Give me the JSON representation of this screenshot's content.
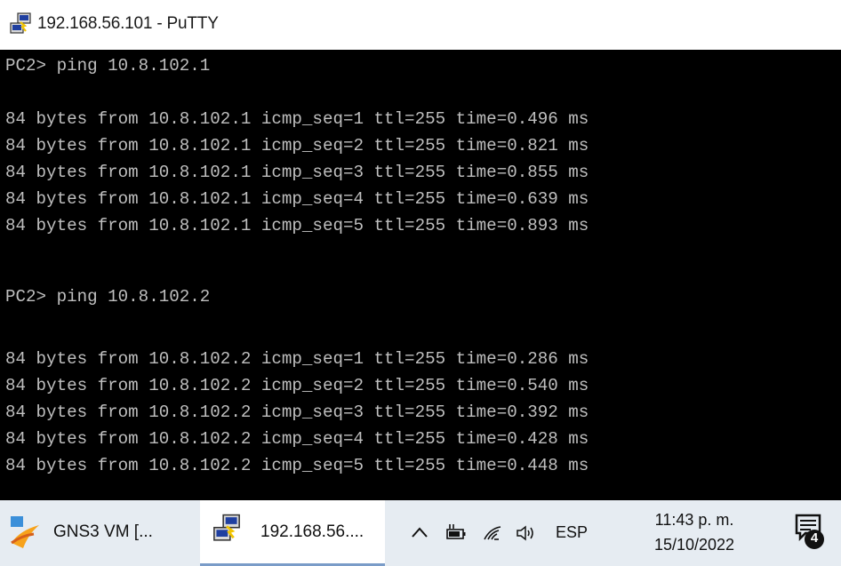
{
  "window": {
    "title": "192.168.56.101 - PuTTY"
  },
  "terminal": {
    "lines": [
      "PC2> ping 10.8.102.1",
      "",
      "84 bytes from 10.8.102.1 icmp_seq=1 ttl=255 time=0.496 ms",
      "84 bytes from 10.8.102.1 icmp_seq=2 ttl=255 time=0.821 ms",
      "84 bytes from 10.8.102.1 icmp_seq=3 ttl=255 time=0.855 ms",
      "84 bytes from 10.8.102.1 icmp_seq=4 ttl=255 time=0.639 ms",
      "84 bytes from 10.8.102.1 icmp_seq=5 ttl=255 time=0.893 ms",
      "",
      "PC2> ping 10.8.102.2",
      "",
      "84 bytes from 10.8.102.2 icmp_seq=1 ttl=255 time=0.286 ms",
      "84 bytes from 10.8.102.2 icmp_seq=2 ttl=255 time=0.540 ms",
      "84 bytes from 10.8.102.2 icmp_seq=3 ttl=255 time=0.392 ms",
      "84 bytes from 10.8.102.2 icmp_seq=4 ttl=255 time=0.428 ms",
      "84 bytes from 10.8.102.2 icmp_seq=5 ttl=255 time=0.448 ms"
    ],
    "colors": {
      "background": "#000000",
      "text": "#bfbfbf"
    }
  },
  "taskbar": {
    "items": [
      {
        "label": "GNS3 VM [...",
        "icon": "gns3-icon",
        "active": false
      },
      {
        "label": "192.168.56....",
        "icon": "putty-icon",
        "active": true
      }
    ],
    "tray": {
      "language": "ESP",
      "time": "11:43 p. m.",
      "date": "15/10/2022",
      "notification_count": "4"
    },
    "colors": {
      "background": "#e6ecf2",
      "active": "#ffffff",
      "accent": "#7a9cc8"
    }
  }
}
